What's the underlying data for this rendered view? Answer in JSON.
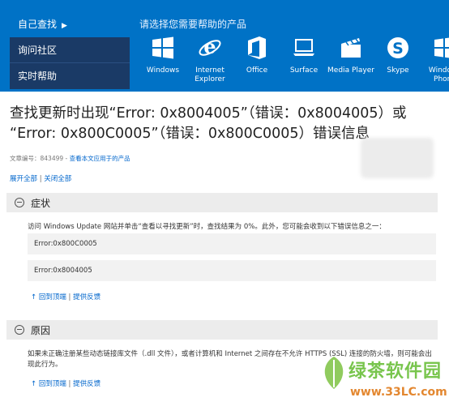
{
  "nav": {
    "items": [
      {
        "label": "自己查找",
        "active": true
      },
      {
        "label": "询问社区",
        "active": false
      },
      {
        "label": "实时帮助",
        "active": false
      }
    ],
    "prompt": "请选择您需要帮助的产品"
  },
  "products": [
    {
      "line1": "Windows",
      "line2": "",
      "icon": "windows-icon"
    },
    {
      "line1": "Internet",
      "line2": "Explorer",
      "icon": "internet-explorer-icon"
    },
    {
      "line1": "Office",
      "line2": "",
      "icon": "office-icon"
    },
    {
      "line1": "Surface",
      "line2": "",
      "icon": "surface-icon"
    },
    {
      "line1": "Media Player",
      "line2": "",
      "icon": "media-player-icon"
    },
    {
      "line1": "Skype",
      "line2": "",
      "icon": "skype-icon"
    },
    {
      "line1": "Windows",
      "line2": "Phone",
      "icon": "windows-phone-icon"
    }
  ],
  "article": {
    "title_line1": "查找更新时出现“Error: 0x8004005”（错误：0x8004005）或",
    "title_line2": "“Error: 0x800C0005”（错误：0x800C0005）错误信息",
    "id_label": "文章编号：843499",
    "applies_link": "查看本文应用于的产品",
    "expand_all": "展开全部",
    "collapse_all": "关闭全部"
  },
  "sections": [
    {
      "title": "症状",
      "text": "访问 Windows Update 网站并单击“查看以寻找更新”时，查找结果为 0%。此外，您可能会收到以下错误信息之一：",
      "codes": [
        "Error:0x800C0005",
        "Error:0x8004005"
      ],
      "back_to_top": "↑ 回到顶端",
      "feedback": "提供反馈"
    },
    {
      "title": "原因",
      "text": "如果未正确注册某些动态链接库文件（.dll 文件），或者计算机和 Internet 之间存在不允许 HTTPS (SSL) 连接的防火墙，则可能会出现此行为。",
      "back_to_top": "↑ 回到顶端",
      "feedback": "提供反馈"
    }
  ],
  "watermark": {
    "name": "绿茶软件园",
    "url": "www.33LC.com"
  },
  "colors": {
    "accent": "#0072c6",
    "nav_dark": "#1a3a66",
    "link": "#0066cc",
    "section_bg": "#ececec"
  }
}
